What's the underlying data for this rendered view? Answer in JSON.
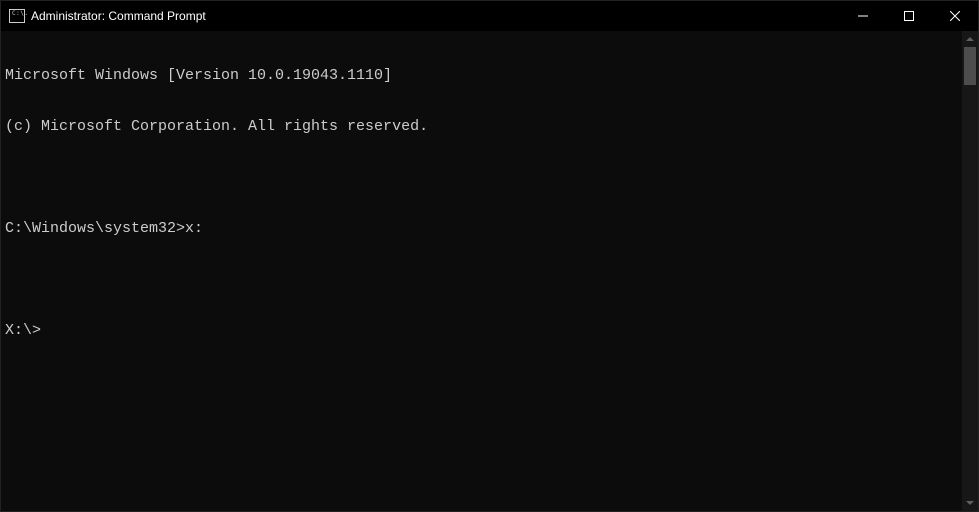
{
  "titlebar": {
    "title": "Administrator: Command Prompt",
    "icon_label": "cmd-icon"
  },
  "terminal": {
    "lines": [
      "Microsoft Windows [Version 10.0.19043.1110]",
      "(c) Microsoft Corporation. All rights reserved.",
      "",
      "C:\\Windows\\system32>x:",
      "",
      "X:\\>",
      ""
    ]
  },
  "cmd_icon_text": "C:\\."
}
